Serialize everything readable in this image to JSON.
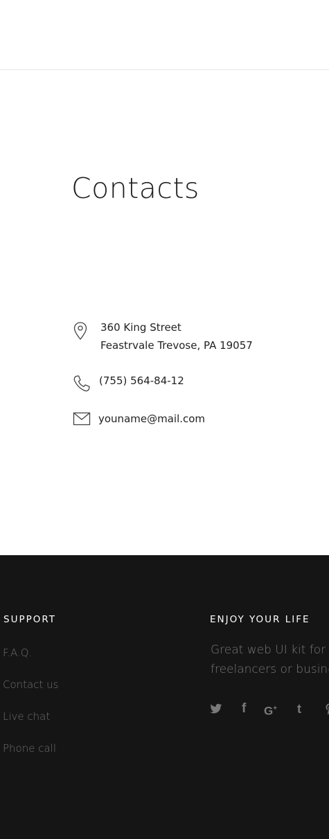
{
  "contacts": {
    "title": "Contacts",
    "address_line1": "360 King Street",
    "address_line2": "Feastrvale Trevose, PA 19057",
    "phone": "(755) 564-84-12",
    "email": "youname@mail.com"
  },
  "footer": {
    "support_heading": "SUPPORT",
    "support_links": [
      "F.A.Q.",
      "Contact us",
      "Live chat",
      "Phone call"
    ],
    "enjoy_heading": "ENJOY YOUR LIFE",
    "enjoy_text_line1": "Great web UI kit for",
    "enjoy_text_line2": "freelancers or business",
    "social_icons": [
      "twitter-icon",
      "facebook-icon",
      "google-plus-icon",
      "tumblr-icon",
      "pinterest-icon"
    ]
  },
  "colors": {
    "footer_background": "#151515",
    "text_dark": "#1f1f1f",
    "footer_link": "#6e6e6e",
    "icon_gray": "#7a7a7a"
  }
}
